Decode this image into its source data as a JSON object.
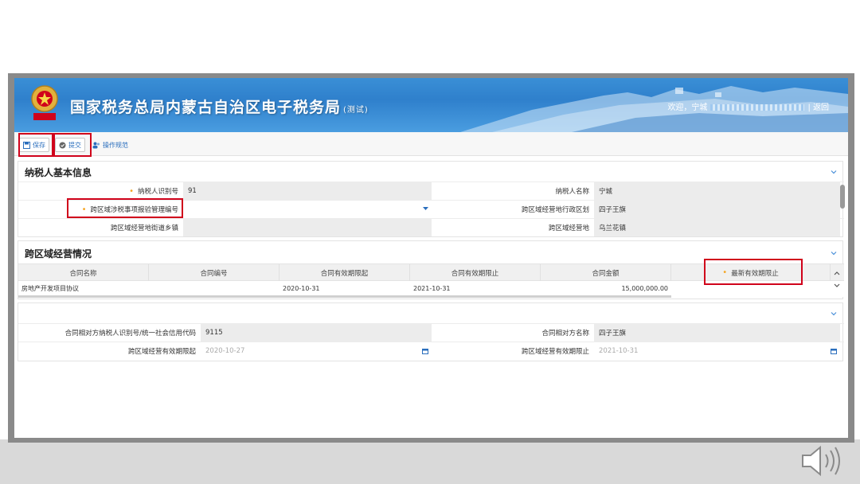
{
  "header": {
    "title": "国家税务总局内蒙古自治区电子税务局",
    "title_suffix": "(测试)",
    "welcome_prefix": "欢迎，宁城",
    "return_link": "| 返回",
    "brand_color": "#2f80cc"
  },
  "toolbar": {
    "save_label": "保存",
    "submit_label": "提交",
    "guide_label": "操作规范"
  },
  "basic_info": {
    "title": "纳税人基本信息",
    "taxpayer_id_label": "纳税人识别号",
    "taxpayer_id_value": "91",
    "taxpayer_name_label": "纳税人名称",
    "taxpayer_name_value": "宁城",
    "permit_no_label": "跨区域涉税事项报验管理编号",
    "permit_no_value": "",
    "admin_region_label": "跨区域经营地行政区划",
    "admin_region_value": "四子王旗",
    "street_label": "跨区域经营地街道乡镇",
    "street_value": "",
    "location_label": "跨区域经营地",
    "location_value": "乌兰花镇"
  },
  "business": {
    "title": "跨区域经营情况",
    "columns": [
      "合同名称",
      "合同编号",
      "合同有效期限起",
      "合同有效期限止",
      "合同金额",
      "最新有效期限止"
    ],
    "rows": [
      {
        "name": "房地产开发项目协议",
        "number": "",
        "start": "2020-10-31",
        "end": "2021-10-31",
        "amount": "15,000,000.00",
        "latest_end": ""
      }
    ]
  },
  "counterparty": {
    "id_label": "合同相对方纳税人识别号/统一社会信用代码",
    "id_value": "9115",
    "name_label": "合同相对方名称",
    "name_value": "四子王旗",
    "valid_from_label": "跨区域经营有效期限起",
    "valid_from_value": "2020-10-27",
    "valid_to_label": "跨区域经营有效期限止",
    "valid_to_value": "2021-10-31"
  },
  "colors": {
    "required_star": "#f5a623",
    "highlight_box": "#d0021b",
    "link_blue": "#2a6ebd"
  }
}
